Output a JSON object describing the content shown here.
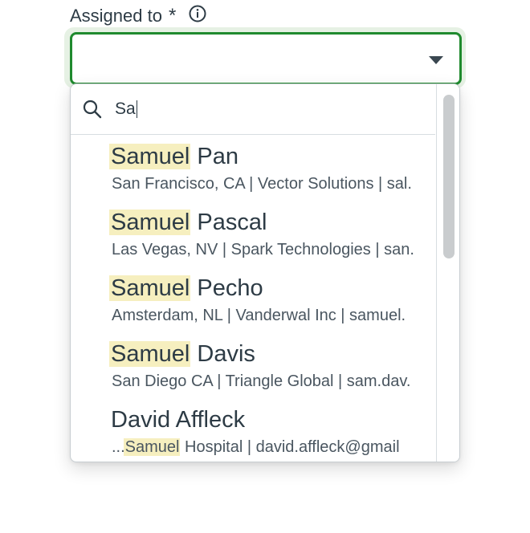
{
  "field": {
    "label": "Assigned to",
    "required_marker": "*",
    "info_icon": "info-circle-icon",
    "value": ""
  },
  "search": {
    "query": "Sa",
    "icon": "search-icon"
  },
  "options": [
    {
      "highlight": "Samuel",
      "rest": " Pan",
      "detail_prefix": "",
      "detail_highlight": "",
      "detail": "San Francisco, CA | Vector Solutions | sal."
    },
    {
      "highlight": "Samuel",
      "rest": " Pascal",
      "detail_prefix": "",
      "detail_highlight": "",
      "detail": "Las Vegas, NV | Spark Technologies | san."
    },
    {
      "highlight": "Samuel",
      "rest": " Pecho",
      "detail_prefix": "",
      "detail_highlight": "",
      "detail": "Amsterdam, NL | Vanderwal Inc | samuel."
    },
    {
      "highlight": "Samuel",
      "rest": " Davis",
      "detail_prefix": "",
      "detail_highlight": "",
      "detail": "San Diego CA | Triangle Global | sam.dav."
    },
    {
      "highlight": "",
      "rest": "David Affleck",
      "detail_prefix": "...",
      "detail_highlight": "Samuel",
      "detail": " Hospital | david.affleck@gmail"
    }
  ],
  "colors": {
    "focus_border": "#1f8a2e",
    "focus_ring": "#e6f1e4",
    "match_highlight": "#f6efbf",
    "text": "#2d3b45"
  }
}
